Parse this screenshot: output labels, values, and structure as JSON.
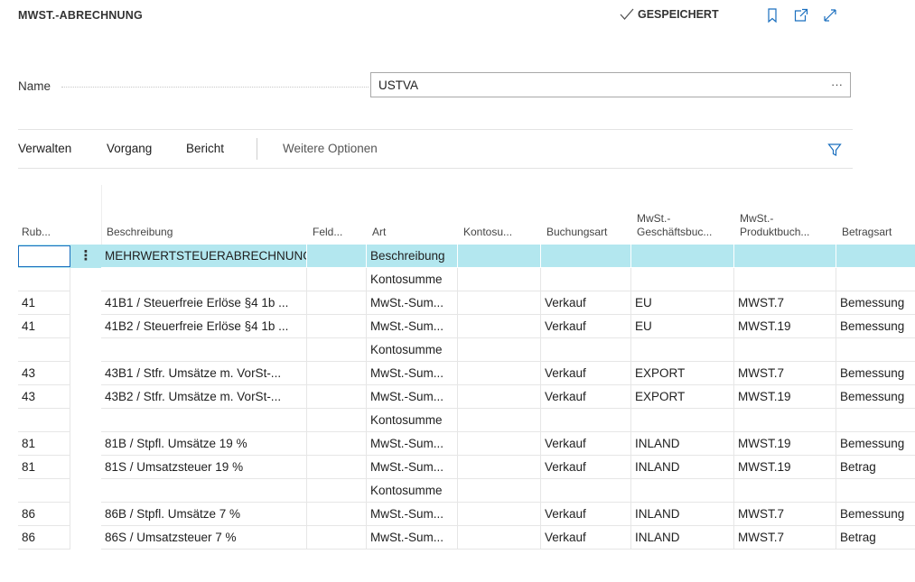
{
  "header": {
    "title": "MWST.-ABRECHNUNG",
    "saved_label": "GESPEICHERT"
  },
  "name_field": {
    "label": "Name",
    "value": "USTVA"
  },
  "actions": [
    "Verwalten",
    "Vorgang",
    "Bericht",
    "Weitere Optionen"
  ],
  "columns": [
    {
      "key": "rub",
      "label": "Rub..."
    },
    {
      "key": "beschreibung",
      "label": "Beschreibung"
    },
    {
      "key": "feld",
      "label": "Feld..."
    },
    {
      "key": "art",
      "label": "Art"
    },
    {
      "key": "kontosu",
      "label": "Kontosu..."
    },
    {
      "key": "buchungsart",
      "label": "Buchungsart"
    },
    {
      "key": "geschaeft",
      "label": "MwSt.-\nGeschäftsbuc..."
    },
    {
      "key": "produkt",
      "label": "MwSt.-\nProduktbuch..."
    },
    {
      "key": "betragsart",
      "label": "Betragsart"
    }
  ],
  "rows": [
    {
      "rub": "",
      "beschreibung": "MEHRWERTSTEUERABRECHNUNG",
      "feld": "",
      "art": "Beschreibung",
      "kontosu": "",
      "buchungsart": "",
      "geschaeft": "",
      "produkt": "",
      "betragsart": "",
      "selected": true
    },
    {
      "rub": "",
      "beschreibung": "",
      "feld": "",
      "art": "Kontosumme",
      "kontosu": "",
      "buchungsart": "",
      "geschaeft": "",
      "produkt": "",
      "betragsart": ""
    },
    {
      "rub": "41",
      "beschreibung": "41B1 / Steuerfreie Erlöse §4 1b ...",
      "feld": "",
      "art": "MwSt.-Sum...",
      "kontosu": "",
      "buchungsart": "Verkauf",
      "geschaeft": "EU",
      "produkt": "MWST.7",
      "betragsart": "Bemessung"
    },
    {
      "rub": "41",
      "beschreibung": "41B2 / Steuerfreie Erlöse §4 1b ...",
      "feld": "",
      "art": "MwSt.-Sum...",
      "kontosu": "",
      "buchungsart": "Verkauf",
      "geschaeft": "EU",
      "produkt": "MWST.19",
      "betragsart": "Bemessung"
    },
    {
      "rub": "",
      "beschreibung": "",
      "feld": "",
      "art": "Kontosumme",
      "kontosu": "",
      "buchungsart": "",
      "geschaeft": "",
      "produkt": "",
      "betragsart": ""
    },
    {
      "rub": "43",
      "beschreibung": "43B1 / Stfr. Umsätze m. VorSt-...",
      "feld": "",
      "art": "MwSt.-Sum...",
      "kontosu": "",
      "buchungsart": "Verkauf",
      "geschaeft": "EXPORT",
      "produkt": "MWST.7",
      "betragsart": "Bemessung"
    },
    {
      "rub": "43",
      "beschreibung": "43B2 / Stfr. Umsätze m. VorSt-...",
      "feld": "",
      "art": "MwSt.-Sum...",
      "kontosu": "",
      "buchungsart": "Verkauf",
      "geschaeft": "EXPORT",
      "produkt": "MWST.19",
      "betragsart": "Bemessung"
    },
    {
      "rub": "",
      "beschreibung": "",
      "feld": "",
      "art": "Kontosumme",
      "kontosu": "",
      "buchungsart": "",
      "geschaeft": "",
      "produkt": "",
      "betragsart": ""
    },
    {
      "rub": "81",
      "beschreibung": "81B / Stpfl. Umsätze 19 %",
      "feld": "",
      "art": "MwSt.-Sum...",
      "kontosu": "",
      "buchungsart": "Verkauf",
      "geschaeft": "INLAND",
      "produkt": "MWST.19",
      "betragsart": "Bemessung"
    },
    {
      "rub": "81",
      "beschreibung": "81S / Umsatzsteuer 19 %",
      "feld": "",
      "art": "MwSt.-Sum...",
      "kontosu": "",
      "buchungsart": "Verkauf",
      "geschaeft": "INLAND",
      "produkt": "MWST.19",
      "betragsart": "Betrag"
    },
    {
      "rub": "",
      "beschreibung": "",
      "feld": "",
      "art": "Kontosumme",
      "kontosu": "",
      "buchungsart": "",
      "geschaeft": "",
      "produkt": "",
      "betragsart": ""
    },
    {
      "rub": "86",
      "beschreibung": "86B / Stpfl. Umsätze 7 %",
      "feld": "",
      "art": "MwSt.-Sum...",
      "kontosu": "",
      "buchungsart": "Verkauf",
      "geschaeft": "INLAND",
      "produkt": "MWST.7",
      "betragsart": "Bemessung"
    },
    {
      "rub": "86",
      "beschreibung": "86S / Umsatzsteuer 7 %",
      "feld": "",
      "art": "MwSt.-Sum...",
      "kontosu": "",
      "buchungsart": "Verkauf",
      "geschaeft": "INLAND",
      "produkt": "MWST.7",
      "betragsart": "Betrag"
    }
  ],
  "colors": {
    "selected_row": "#b3e7ef",
    "focus_border": "#1a6fbf"
  }
}
